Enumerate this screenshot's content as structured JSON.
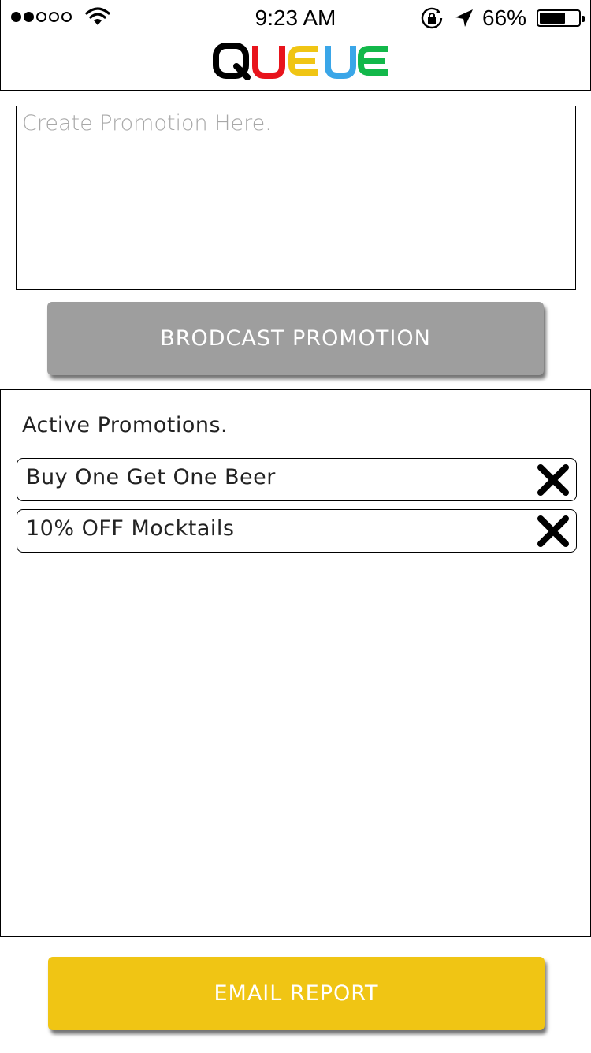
{
  "status_bar": {
    "time": "9:23 AM",
    "battery_percent": "66%",
    "battery_level": 0.66,
    "signal_bars_filled": 2,
    "signal_bars_total": 5,
    "icons": [
      "signal-dots-icon",
      "wifi-icon",
      "rotation-lock-icon",
      "location-arrow-icon",
      "battery-icon"
    ]
  },
  "header": {
    "logo_letters": [
      {
        "char": "Q",
        "color": "#000000"
      },
      {
        "char": "U",
        "color": "#e8141c"
      },
      {
        "char": "E",
        "color": "#f0c514"
      },
      {
        "char": "U",
        "color": "#3aa6e8"
      },
      {
        "char": "E",
        "color": "#12b84a"
      }
    ]
  },
  "promo_input": {
    "placeholder": "Create Promotion Here.",
    "value": ""
  },
  "broadcast_button": {
    "label": "BRODCAST PROMOTION",
    "color": "#9e9e9e"
  },
  "active_promotions": {
    "title": "Active Promotions.",
    "items": [
      {
        "label": "Buy One Get One Beer",
        "remove_icon": "close-x-icon"
      },
      {
        "label": "10% OFF Mocktails",
        "remove_icon": "close-x-icon"
      }
    ]
  },
  "email_button": {
    "label": "EMAIL REPORT",
    "color": "#f0c514"
  }
}
